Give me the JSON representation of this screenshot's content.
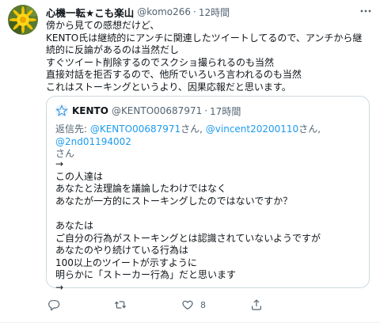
{
  "tweet": {
    "author_name": "心機一転★こも楽山",
    "handle": "@komo266",
    "separator": "·",
    "time": "12時間",
    "avatar_icon": "dandelion-avatar",
    "more_icon": "more-icon",
    "body_lines": [
      "傍から見ての感想だけど、",
      "KENTO氏は継続的にアンチに関連したツイートしてるので、アンチから継",
      "続的に反論があるのは当然だし",
      "すぐツイート削除するのでスクショ撮られるのも当然",
      "直接対話を拒否するので、他所でいろいろ言われるのも当然",
      "これはストーキングというより、因果応報だと思います。"
    ]
  },
  "quote": {
    "avatar_icon": "star-avatar",
    "author_name": "KENTO",
    "handle": "@KENTO00687971",
    "separator": "·",
    "time": "17時間",
    "reply_prefix": "返信先: ",
    "reply_to_1": "@KENTO00687971",
    "reply_sep_1": "さん, ",
    "reply_to_2": "@vincent20200110",
    "reply_sep_2": "さん, ",
    "reply_to_3": "@2nd01194002",
    "reply_suffix": "さん",
    "text_lines": [
      "→",
      "この人達は",
      "あなたと法理論を議論したわけではなく",
      "あなたが一方的にストーキングしたのではないですか？",
      "",
      "あなたは",
      "ご自分の行為がストーキングとは認識されていないようですが",
      "あなたのやり続けている行為は",
      "100以上のツイートが示すように",
      "明らかに「ストーカー行為」だと思います",
      "→"
    ]
  },
  "actions": {
    "reply_icon": "reply-icon",
    "retweet_icon": "retweet-icon",
    "like_icon": "heart-icon",
    "like_count": "8",
    "share_icon": "share-icon"
  },
  "colors": {
    "text": "#0f1419",
    "secondary": "#536471",
    "link": "#1d9bf0",
    "border": "#cfd9de"
  }
}
